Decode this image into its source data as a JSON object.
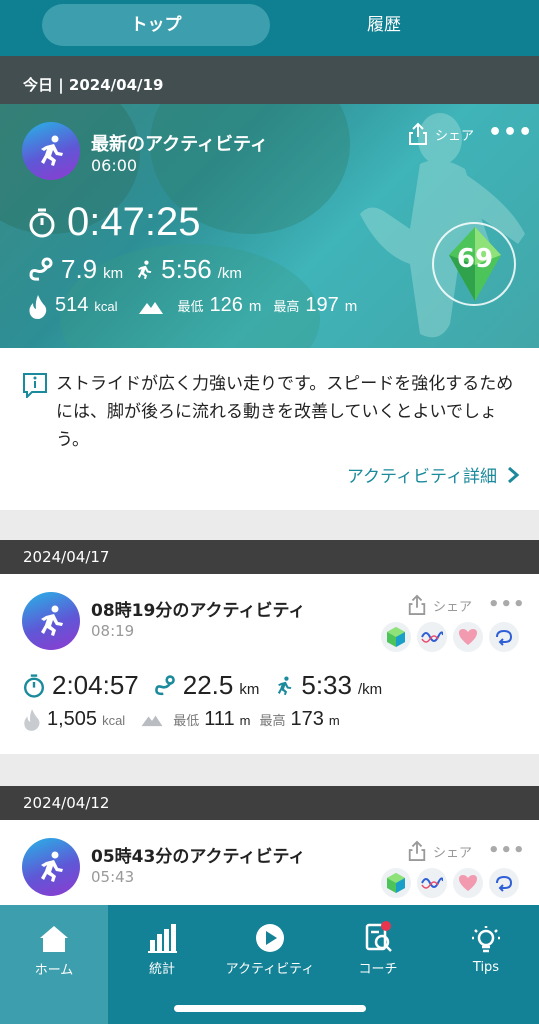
{
  "tabs": {
    "top": "トップ",
    "history": "履歴"
  },
  "today": {
    "header": "今日 | 2024/04/19",
    "title": "最新のアクティビティ",
    "time": "06:00",
    "share": "シェア",
    "duration": "0:47:25",
    "distance": "7.9",
    "distance_unit": "km",
    "pace": "5:56",
    "pace_unit": "/km",
    "calories": "514",
    "calories_unit": "kcal",
    "min_label": "最低",
    "min_alt": "126",
    "max_label": "最高",
    "max_alt": "197",
    "alt_unit": "m",
    "score": "69"
  },
  "advice": {
    "text": "ストライドが広く力強い走りです。スピードを強化するためには、脚が後ろに流れる動きを改善していくとよいでしょう。",
    "link": "アクティビティ詳細"
  },
  "activities": [
    {
      "date": "2024/04/17",
      "title": "08時19分のアクティビティ",
      "time": "08:19",
      "share": "シェア",
      "duration": "2:04:57",
      "distance": "22.5",
      "distance_unit": "km",
      "pace": "5:33",
      "pace_unit": "/km",
      "calories": "1,505",
      "calories_unit": "kcal",
      "min_label": "最低",
      "min_alt": "111",
      "max_label": "最高",
      "max_alt": "173",
      "alt_unit": "m"
    },
    {
      "date": "2024/04/12",
      "title": "05時43分のアクティビティ",
      "time": "05:43",
      "share": "シェア"
    }
  ],
  "nav": [
    {
      "label": "ホーム",
      "icon": "home-icon"
    },
    {
      "label": "統計",
      "icon": "bar-chart-icon"
    },
    {
      "label": "アクティビティ",
      "icon": "play-icon"
    },
    {
      "label": "コーチ",
      "icon": "coach-icon"
    },
    {
      "label": "Tips",
      "icon": "lightbulb-icon"
    }
  ],
  "colors": {
    "primary": "#138196",
    "accent": "#1a8a9c",
    "score_green": "#5dd35b"
  }
}
